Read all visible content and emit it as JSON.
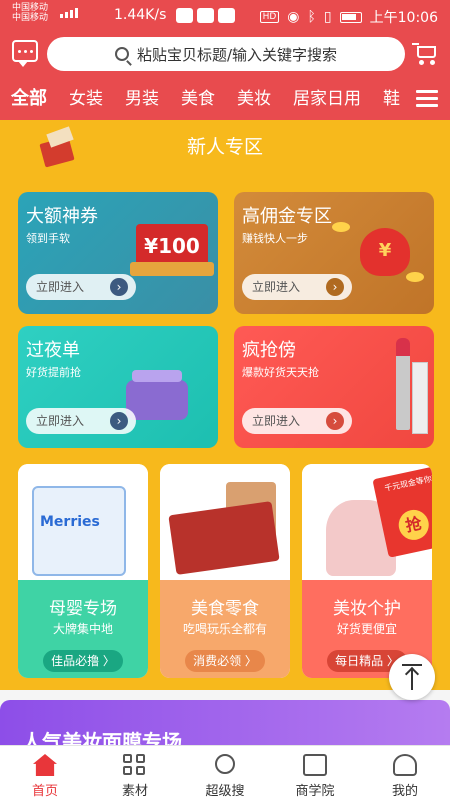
{
  "status_bar": {
    "carrier1": "中国移动",
    "carrier2": "中国移动",
    "network1": "4G",
    "network2": "2G",
    "speed": "1.44K/s",
    "hd_badge": "HD",
    "time": "上午10:06"
  },
  "header": {
    "search_placeholder": "粘贴宝贝标题/输入关键字搜索",
    "categories": [
      "全部",
      "女装",
      "男装",
      "美食",
      "美妆",
      "居家日用",
      "鞋"
    ]
  },
  "newcomer": {
    "title": "新人专区",
    "cards": [
      {
        "title": "大额神券",
        "subtitle": "领到手软",
        "button": "立即进入",
        "price_tag": "¥100"
      },
      {
        "title": "高佣金专区",
        "subtitle": "赚钱快人一步",
        "button": "立即进入",
        "coin_symbol": "¥"
      },
      {
        "title": "过夜单",
        "subtitle": "好货提前抢",
        "button": "立即进入"
      },
      {
        "title": "疯抢傍",
        "subtitle": "爆款好货天天抢",
        "button": "立即进入"
      }
    ]
  },
  "products": [
    {
      "title": "母婴专场",
      "subtitle": "大牌集中地",
      "button": "佳品必撸 〉",
      "brand": "Merries"
    },
    {
      "title": "美食零食",
      "subtitle": "吃喝玩乐全都有",
      "button": "消费必领 〉"
    },
    {
      "title": "美妆个护",
      "subtitle": "好货更便宜",
      "button": "每日精品 〉",
      "promo": "千元现金等你来",
      "promo_badge": "抢"
    }
  ],
  "banner": {
    "title": "人气美妆面膜专场"
  },
  "tabbar": {
    "items": [
      "首页",
      "素材",
      "超级搜",
      "商学院",
      "我的"
    ],
    "active": "首页"
  },
  "colors": {
    "brand": "#e84b4e",
    "main_bg": "#f7b91c",
    "active_tab": "#e8363a"
  }
}
